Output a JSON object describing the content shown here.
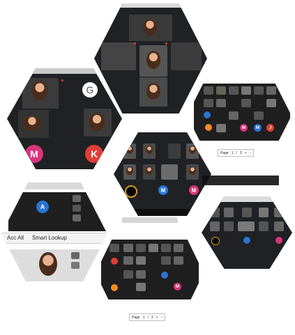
{
  "colors": {
    "accent_red": "#e03e36",
    "meet_dark": "#1f1f1f",
    "avatar_blue": "#2a74d4",
    "avatar_pink": "#d8347a"
  },
  "icons": [
    "google-g-icon",
    "mic-icon",
    "zoom-in-icon",
    "zoom-out-icon"
  ],
  "hex_left": {
    "avatar_a": "M",
    "avatar_b": "K"
  },
  "hex_center": {
    "avatar_a": "M",
    "avatar_b": "M"
  },
  "hex_right_top": {
    "avatar_a": "M",
    "avatar_b": "M",
    "avatar_c": "J",
    "pager": {
      "page": "Page",
      "number": "1",
      "of": "/",
      "total": "3"
    }
  },
  "hex_left_lower": {
    "avatar": "A",
    "toolbar_left": "Acc All",
    "toolbar_right": "Smart Lookup"
  },
  "hex_bottom": {
    "avatar_a": "M",
    "pager": {
      "page": "Page",
      "number": "1",
      "of": "/",
      "total": "3"
    }
  }
}
